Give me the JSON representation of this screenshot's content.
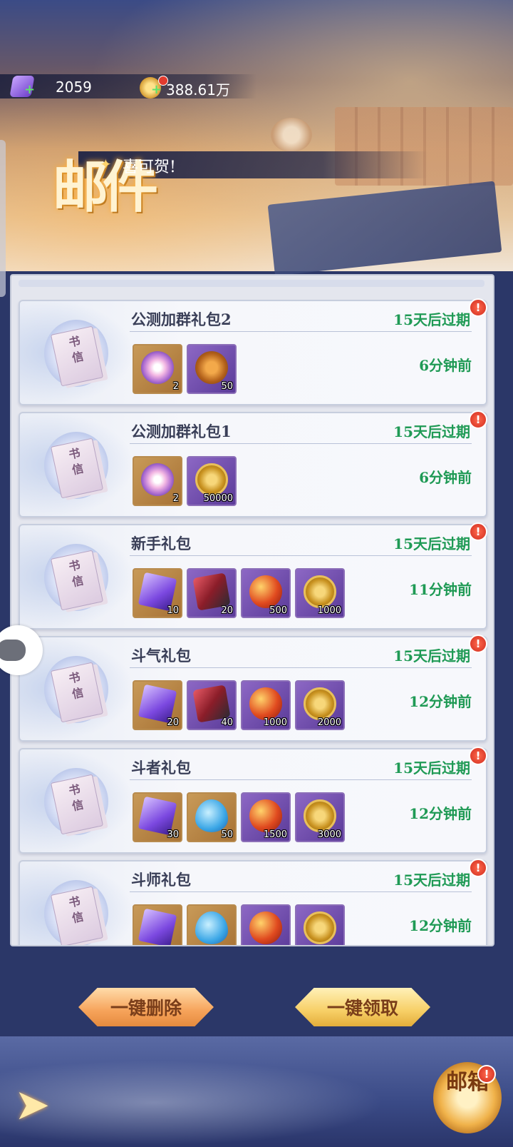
{
  "resources": {
    "crystal": {
      "icon": "purple-crystal-icon",
      "value": "2059"
    },
    "coin": {
      "icon": "gold-coin-icon",
      "value": "388.61万"
    }
  },
  "header": {
    "title": "邮件",
    "ribbon_text": "喜可贺!"
  },
  "mails": [
    {
      "title": "公测加群礼包2",
      "expire": "15天后过期",
      "time": "6分钟前",
      "sender_icon": "书信",
      "items": [
        {
          "icon": "flower-gem-icon",
          "count": "2",
          "bg": "gold",
          "art": "art-flower"
        },
        {
          "icon": "bronze-coin-icon",
          "count": "50",
          "bg": "purple",
          "art": "art-bronze"
        }
      ]
    },
    {
      "title": "公测加群礼包1",
      "expire": "15天后过期",
      "time": "6分钟前",
      "sender_icon": "书信",
      "items": [
        {
          "icon": "flower-gem-icon",
          "count": "2",
          "bg": "gold",
          "art": "art-flower"
        },
        {
          "icon": "gold-coin-icon",
          "count": "50000",
          "bg": "purple",
          "art": "art-coin"
        }
      ]
    },
    {
      "title": "新手礼包",
      "expire": "15天后过期",
      "time": "11分钟前",
      "sender_icon": "书信",
      "items": [
        {
          "icon": "purple-crystal-icon",
          "count": "10",
          "bg": "gold",
          "art": "art-crystal"
        },
        {
          "icon": "red-ore-icon",
          "count": "20",
          "bg": "purple",
          "art": "art-rock"
        },
        {
          "icon": "fire-orb-icon",
          "count": "500",
          "bg": "purple",
          "art": "art-orb"
        },
        {
          "icon": "gold-coin-icon",
          "count": "1000",
          "bg": "purple",
          "art": "art-coin"
        }
      ]
    },
    {
      "title": "斗气礼包",
      "expire": "15天后过期",
      "time": "12分钟前",
      "sender_icon": "书信",
      "items": [
        {
          "icon": "purple-crystal-icon",
          "count": "20",
          "bg": "gold",
          "art": "art-crystal"
        },
        {
          "icon": "red-ore-icon",
          "count": "40",
          "bg": "purple",
          "art": "art-rock"
        },
        {
          "icon": "fire-orb-icon",
          "count": "1000",
          "bg": "purple",
          "art": "art-orb"
        },
        {
          "icon": "gold-coin-icon",
          "count": "2000",
          "bg": "purple",
          "art": "art-coin"
        }
      ]
    },
    {
      "title": "斗者礼包",
      "expire": "15天后过期",
      "time": "12分钟前",
      "sender_icon": "书信",
      "items": [
        {
          "icon": "purple-crystal-icon",
          "count": "30",
          "bg": "gold",
          "art": "art-crystal"
        },
        {
          "icon": "water-drop-icon",
          "count": "50",
          "bg": "gold",
          "art": "art-drop"
        },
        {
          "icon": "fire-orb-icon",
          "count": "1500",
          "bg": "purple",
          "art": "art-orb"
        },
        {
          "icon": "gold-coin-icon",
          "count": "3000",
          "bg": "purple",
          "art": "art-coin"
        }
      ]
    },
    {
      "title": "斗师礼包",
      "expire": "15天后过期",
      "time": "12分钟前",
      "sender_icon": "书信",
      "items": [
        {
          "icon": "purple-crystal-icon",
          "count": "",
          "bg": "gold",
          "art": "art-crystal"
        },
        {
          "icon": "water-drop-icon",
          "count": "",
          "bg": "gold",
          "art": "art-drop"
        },
        {
          "icon": "fire-orb-icon",
          "count": "",
          "bg": "purple",
          "art": "art-orb"
        },
        {
          "icon": "gold-coin-icon",
          "count": "",
          "bg": "purple",
          "art": "art-coin"
        }
      ]
    }
  ],
  "buttons": {
    "delete_all": "一键删除",
    "claim_all": "一键领取"
  },
  "footer": {
    "mailbox_label": "邮箱",
    "alert_mark": "!"
  },
  "colors": {
    "accent_green": "#1f9a55",
    "alert_red": "#d02a1d",
    "panel_bg": "#e4e6ee"
  }
}
